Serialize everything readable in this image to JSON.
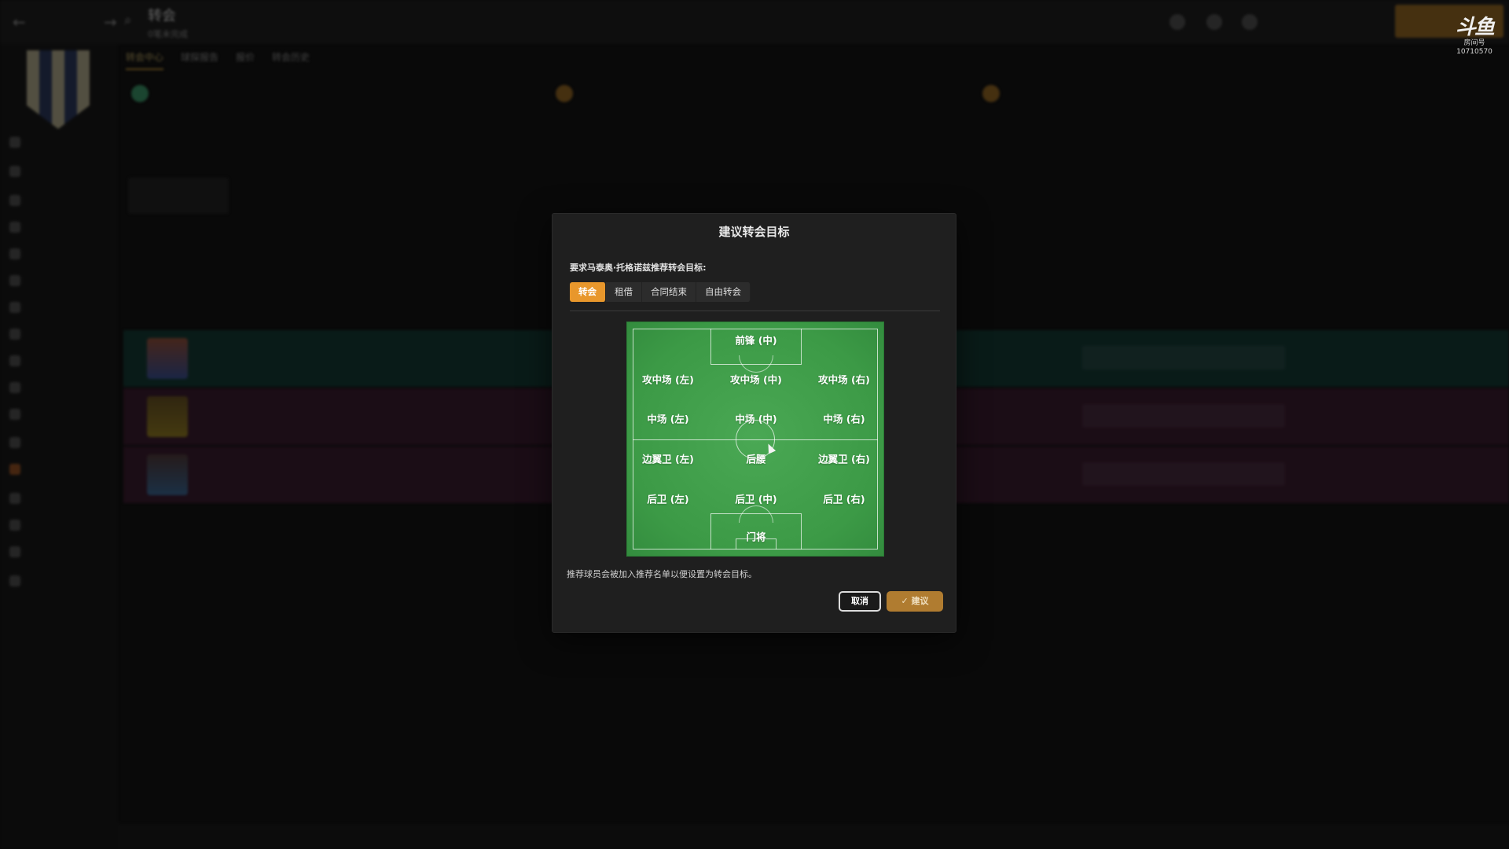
{
  "app": {
    "topbar": {
      "title": "转会",
      "subtitle": "0笔未完成"
    },
    "tabs": [
      "转会中心",
      "球探报告",
      "报价",
      "转会历史"
    ]
  },
  "dialog": {
    "title": "建议转会目标",
    "prompt": "要求马泰奥·托格诺兹推荐转会目标:",
    "type_tabs": [
      "转会",
      "租借",
      "合同结束",
      "自由转会"
    ],
    "active_tab": "转会",
    "positions": {
      "st_c": "前锋 (中)",
      "am_l": "攻中场 (左)",
      "am_c": "攻中场 (中)",
      "am_r": "攻中场 (右)",
      "m_l": "中场 (左)",
      "m_c": "中场 (中)",
      "m_r": "中场 (右)",
      "wb_l": "边翼卫 (左)",
      "dm": "后腰",
      "wb_r": "边翼卫 (右)",
      "d_l": "后卫 (左)",
      "d_c": "后卫 (中)",
      "d_r": "后卫 (右)",
      "gk": "门将"
    },
    "note": "推荐球员会被加入推荐名单以便设置为转会目标。",
    "cancel_label": "取消",
    "confirm_label": "✓ 建议"
  },
  "watermark": {
    "logo": "斗鱼",
    "sub": "房间号",
    "room": "10710570"
  },
  "colors": {
    "accent": "#e8972c",
    "pitch": "#3c9a46",
    "dialog_bg": "#1f1f1f"
  }
}
